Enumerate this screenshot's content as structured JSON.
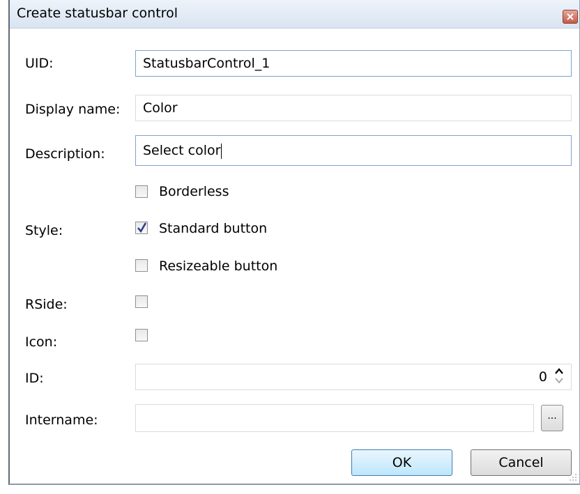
{
  "window": {
    "title": "Create statusbar control",
    "close_icon": "close-icon"
  },
  "form": {
    "uid_label": "UID:",
    "uid_value": "StatusbarControl_1",
    "display_name_label": "Display name:",
    "display_name_value": "Color",
    "description_label": "Description:",
    "description_value": "Select color",
    "style_label": "Style:",
    "borderless_label": "Borderless",
    "borderless_checked": false,
    "standard_button_label": "Standard button",
    "standard_button_checked": true,
    "resizeable_button_label": "Resizeable button",
    "resizeable_button_checked": false,
    "rside_label": "RSide:",
    "rside_checked": false,
    "icon_label": "Icon:",
    "icon_checked": false,
    "id_label": "ID:",
    "id_value": "0",
    "intername_label": "Intername:",
    "intername_value": "",
    "browse_label": "..."
  },
  "buttons": {
    "ok": "OK",
    "cancel": "Cancel"
  },
  "colors": {
    "focus_border": "#7da2ce",
    "ok_border": "#3c7fb1",
    "close_button": "#c65a46"
  }
}
